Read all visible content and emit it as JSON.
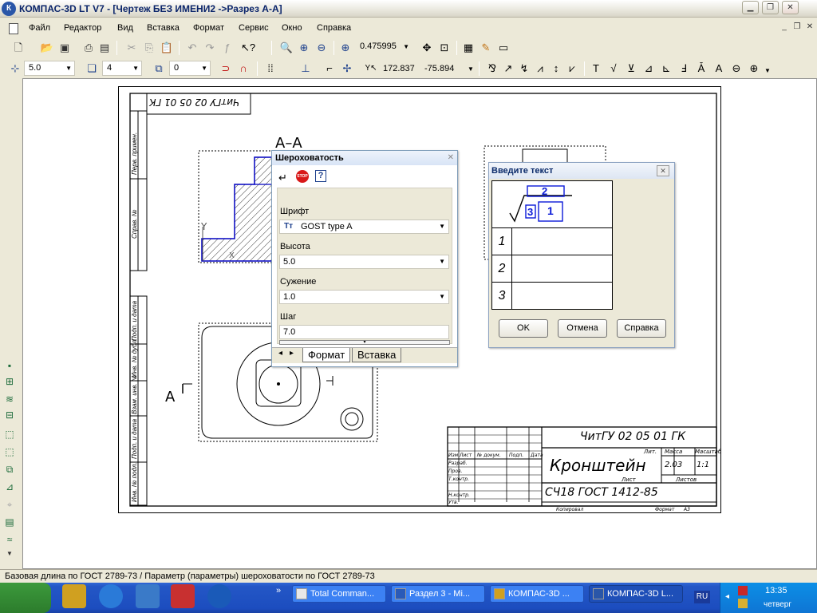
{
  "window": {
    "title": "КОМПАС-3D LT V7 - [Чертеж БЕЗ ИМЕНИ2 ->Разрез А-А]",
    "logo": "К"
  },
  "menu": [
    "Файл",
    "Редактор",
    "Вид",
    "Вставка",
    "Формат",
    "Сервис",
    "Окно",
    "Справка"
  ],
  "toolbar": {
    "zoom": "0.475995"
  },
  "props": {
    "step": "5.0",
    "layer": "4",
    "style": "0",
    "x": "172.837",
    "y": "-75.894"
  },
  "roughness": {
    "title": "Шероховатость",
    "font_label": "Шрифт",
    "font_value": "GOST type A",
    "height_label": "Высота",
    "height_value": "5.0",
    "narrow_label": "Сужение",
    "narrow_value": "1.0",
    "step_label": "Шаг",
    "step_value": "7.0",
    "tab_format": "Формат",
    "tab_insert": "Вставка",
    "stop": "STOP",
    "help": "?"
  },
  "textdlg": {
    "title": "Введите текст",
    "sym_top": "2",
    "sym_left": "3",
    "sym_right": "1",
    "rows": [
      "1",
      "2",
      "3"
    ],
    "ok": "OK",
    "cancel": "Отмена",
    "help": "Справка"
  },
  "drawing": {
    "section": "А–А",
    "view_mark": "А",
    "axis_y": "Y",
    "axis_x": "X",
    "doc_code": "ЧитГУ 02 05 01 ГК",
    "doc_code_rotated": "ЧитГУ 02 05 01 ГК",
    "part_name": "Кронштейн",
    "material": "СЧ18 ГОСТ 1412-85",
    "mass": "2.03",
    "scale": "1:1",
    "lit": "Лит.",
    "massa": "Масса",
    "masshtab": "Масштаб",
    "list": "Лист",
    "listov": "Листов",
    "izm": "Изм.",
    "list2": "Лист",
    "ndoc": "№ докум.",
    "podp": "Подп.",
    "data": "Дата",
    "razrab": "Разраб.",
    "prov": "Пров.",
    "tkontr": "Т.контр.",
    "nkontr": "Н.контр.",
    "utv": "Утв.",
    "kopiroval": "Копировал",
    "format": "Формат",
    "format_val": "А3",
    "side_labels": [
      "Перв. примен.",
      "Справ. №",
      "Подп. и дата",
      "Инв. № дубл.",
      "Взам. инв. №",
      "Подп. и дата",
      "Инв. № подл."
    ]
  },
  "status": "Базовая длина по ГОСТ 2789-73 / Параметр (параметры) шероховатости по ГОСТ 2789-73",
  "taskbar": {
    "items": [
      "Total Comman...",
      "Раздел 3 - Mi...",
      "КОМПАС-3D ...",
      "КОМПАС-3D L..."
    ],
    "lang": "RU",
    "time": "13:35",
    "day": "четверг",
    "more": "»"
  }
}
